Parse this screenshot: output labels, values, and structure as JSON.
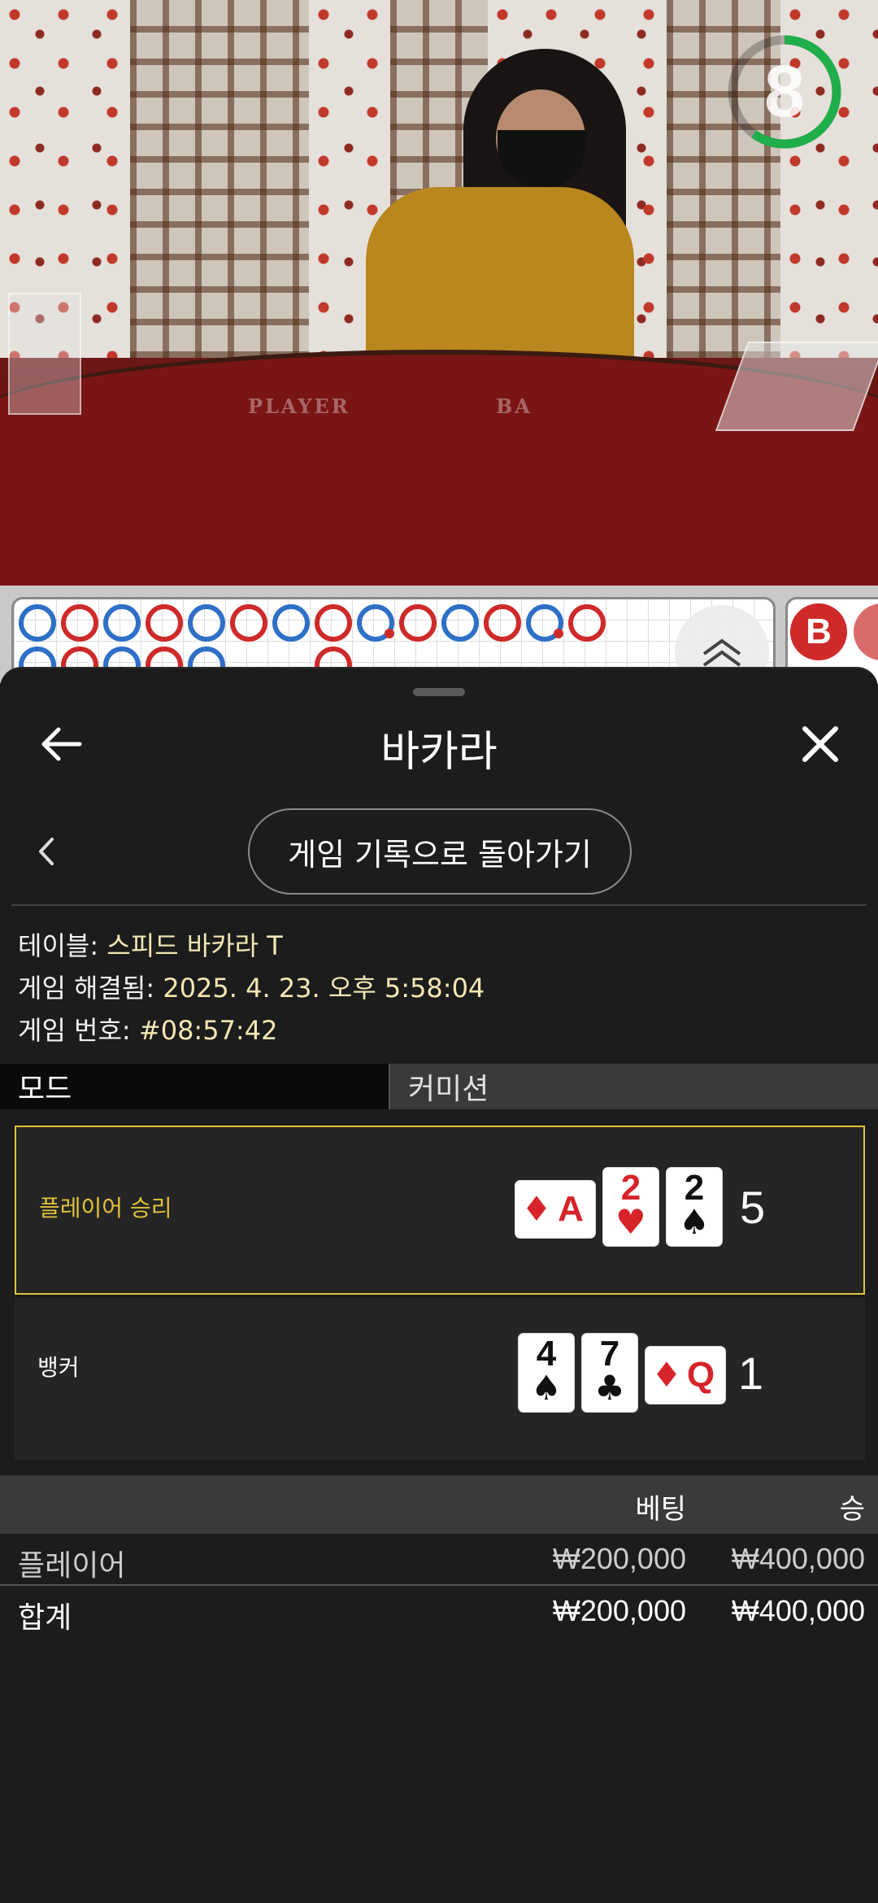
{
  "timer": {
    "seconds": "8",
    "color": "#1fae4a",
    "remaining_fraction": 0.6
  },
  "table_felt": {
    "left_label": "PLAYER",
    "right_label": "BA"
  },
  "roadmap": {
    "top_row": [
      "b",
      "r",
      "b",
      "r",
      "b",
      "r",
      "b",
      "r",
      "b-dot",
      "r",
      "b",
      "r",
      "b-dot",
      "r"
    ],
    "bottom_row": [
      "b",
      "r",
      "b",
      "r",
      "b-partial"
    ],
    "extra": [
      "r"
    ],
    "badge": "B"
  },
  "header": {
    "title": "바카라",
    "back_icon": "arrow-left-icon",
    "close_icon": "close-icon"
  },
  "subnav": {
    "back_icon": "chevron-left-icon",
    "history_button": "게임 기록으로 돌아가기"
  },
  "game_info": {
    "table_label": "테이블:",
    "table_value": "스피드 바카라 T",
    "resolved_label": "게임 해결됨:",
    "resolved_value": "2025. 4. 23. 오후 5:58:04",
    "number_label": "게임 번호:",
    "number_value": "#08:57:42"
  },
  "tabs": [
    {
      "label": "모드"
    },
    {
      "label": "커미션"
    }
  ],
  "results": {
    "player": {
      "label": "플레이어 승리",
      "score": "5",
      "label_color": "#e3c23a",
      "cards": [
        {
          "rank": "A",
          "suit": "♦",
          "color": "red",
          "sideways": true
        },
        {
          "rank": "2",
          "suit": "♥",
          "color": "red"
        },
        {
          "rank": "2",
          "suit": "♠",
          "color": "black"
        }
      ]
    },
    "banker": {
      "label": "뱅커",
      "score": "1",
      "cards": [
        {
          "rank": "4",
          "suit": "♠",
          "color": "black"
        },
        {
          "rank": "7",
          "suit": "♣",
          "color": "black"
        },
        {
          "rank": "Q",
          "suit": "♦",
          "color": "red",
          "sideways": true
        }
      ]
    }
  },
  "bets": {
    "col_bet": "베팅",
    "col_win": "승",
    "rows": [
      {
        "name": "플레이어",
        "bet": "₩200,000",
        "win": "₩400,000"
      }
    ],
    "total": {
      "name": "합계",
      "bet": "₩200,000",
      "win": "₩400,000"
    }
  }
}
